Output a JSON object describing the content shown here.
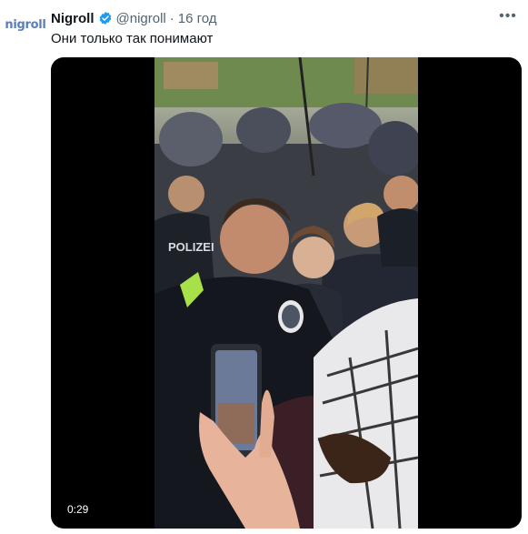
{
  "tweet": {
    "avatar_text": "nigroll",
    "author_name": "Nigroll",
    "handle": "@nigroll",
    "separator": "·",
    "timestamp": "16 год",
    "text": "Они только так понимают",
    "more_icon": "more-horizontal-icon",
    "verified_icon": "verified-badge-icon",
    "colors": {
      "verified": "#1d9bf0",
      "secondary_text": "#536471",
      "avatar_text": "#5b7fb8"
    }
  },
  "video": {
    "duration": "0:29",
    "overlay_text": "POLIZEI"
  }
}
